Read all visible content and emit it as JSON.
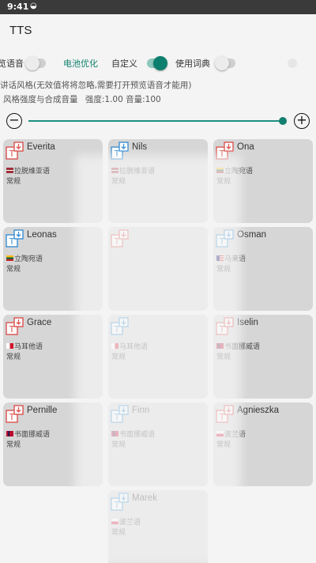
{
  "status_bar": {
    "time": "9:41",
    "signal_icon": "wifi-icon"
  },
  "app": {
    "title": "TTS"
  },
  "toggles": [
    {
      "label": "览语音",
      "on": false
    },
    {
      "label": "电池优化",
      "accent": true
    },
    {
      "label": "自定义",
      "on": true
    },
    {
      "label": "使用词典",
      "on": false
    }
  ],
  "desc": {
    "line1": "讲话风格(无效值将将忽略,需要打开预览语音才能用)",
    "line2": "风格强度与合成音量",
    "line2_values": "强度:1.00 音量:100"
  },
  "slider": {
    "value_fraction": 0.98
  },
  "colors": {
    "accent": "#12806f",
    "icon_red": "#d9534f",
    "icon_blue": "#3a8fd4",
    "card_bg": "#d6d6d6"
  },
  "voices": [
    {
      "name": "Everita",
      "language": "拉脱维亚语",
      "style": "常规",
      "icon_color": "red",
      "flag": "latvia"
    },
    {
      "name": "Nils",
      "language": "拉脱维亚语",
      "style": "常规",
      "icon_color": "blue",
      "flag": "latvia"
    },
    {
      "name": "Ona",
      "language": "立陶宛语",
      "style": "常规",
      "icon_color": "red",
      "flag": "lithuania"
    },
    {
      "name": "Leonas",
      "language": "立陶宛语",
      "style": "常规",
      "icon_color": "blue",
      "flag": "lithuania"
    },
    {
      "name": "",
      "language": "",
      "style": "",
      "icon_color": "red",
      "flag": ""
    },
    {
      "name": "Osman",
      "language": "马来语",
      "style": "常规",
      "icon_color": "blue",
      "flag": "malaysia"
    },
    {
      "name": "Grace",
      "language": "马耳他语",
      "style": "常规",
      "icon_color": "red",
      "flag": "malta"
    },
    {
      "name": "",
      "language": "马耳他语",
      "style": "常规",
      "icon_color": "blue",
      "flag": "malta"
    },
    {
      "name": "Iselin",
      "language": "书面挪威语",
      "style": "常规",
      "icon_color": "red",
      "flag": "norway"
    },
    {
      "name": "Pernille",
      "language": "书面挪威语",
      "style": "常规",
      "icon_color": "red",
      "flag": "norway"
    },
    {
      "name": "Finn",
      "language": "书面挪威语",
      "style": "常规",
      "icon_color": "blue",
      "flag": "norway"
    },
    {
      "name": "Agnieszka",
      "language": "波兰语",
      "style": "常规",
      "icon_color": "red",
      "flag": "poland"
    },
    {
      "name": "Marek",
      "language": "波兰语",
      "style": "常规",
      "icon_color": "blue",
      "flag": "poland"
    }
  ]
}
